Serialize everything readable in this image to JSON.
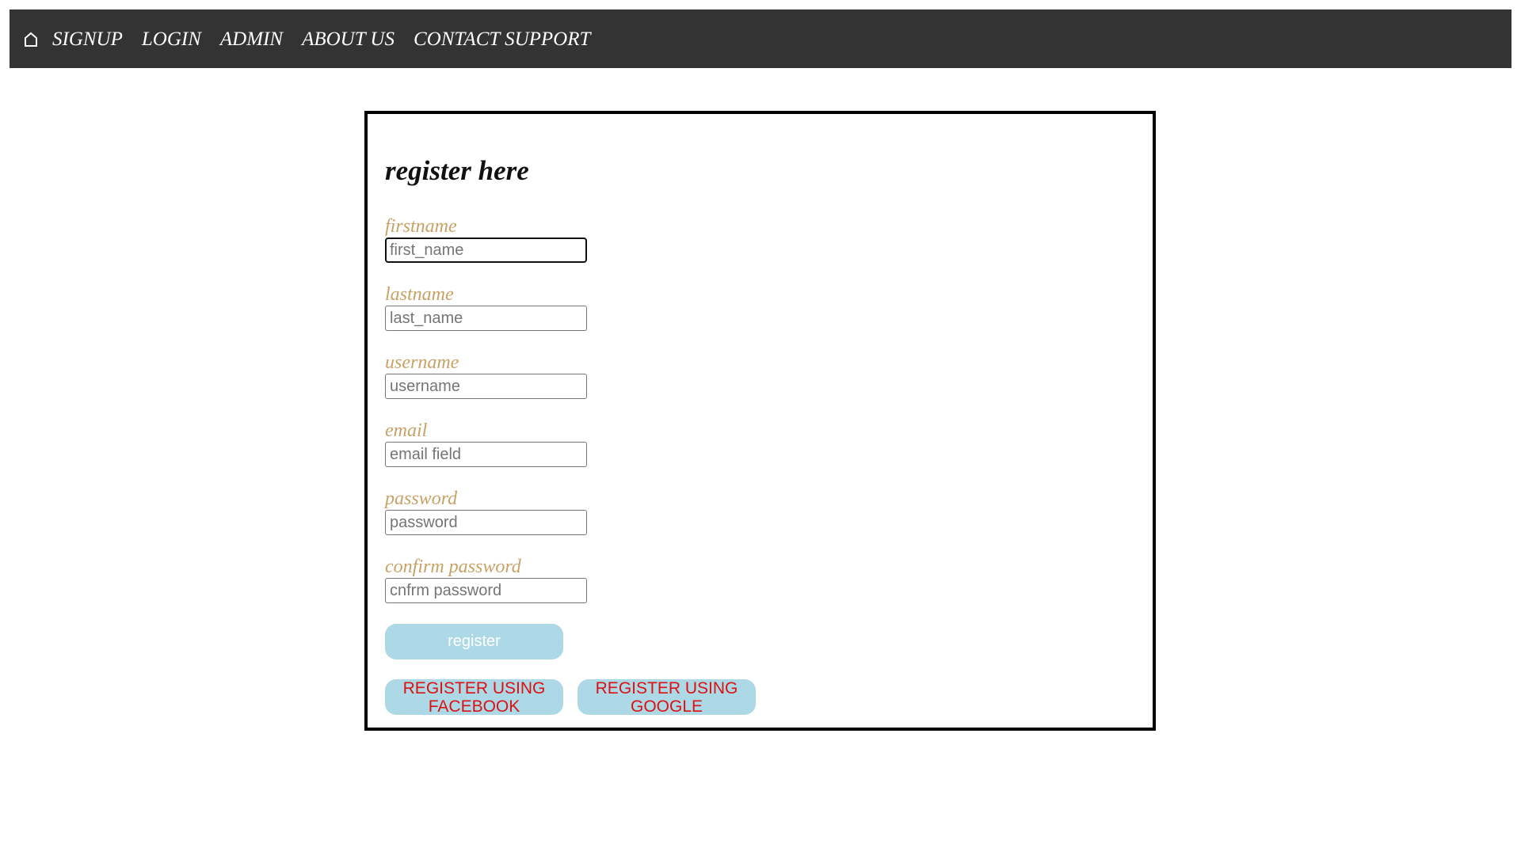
{
  "nav": {
    "home_icon": "home-icon",
    "items": [
      "SIGNUP",
      "LOGIN",
      "ADMIN",
      "ABOUT US",
      "CONTACT SUPPORT"
    ]
  },
  "form": {
    "title": "register here",
    "fields": [
      {
        "label": "firstname",
        "placeholder": "first_name",
        "value": ""
      },
      {
        "label": "lastname",
        "placeholder": "last_name",
        "value": ""
      },
      {
        "label": "username",
        "placeholder": "username",
        "value": ""
      },
      {
        "label": "email",
        "placeholder": "email field",
        "value": ""
      },
      {
        "label": "password",
        "placeholder": "password",
        "value": ""
      },
      {
        "label": "confirm password",
        "placeholder": "cnfrm password",
        "value": ""
      }
    ],
    "register_label": "register",
    "facebook_label": "REGISTER USING FACEBOOK",
    "google_label": "REGISTER USING GOOGLE"
  },
  "colors": {
    "navbar_bg": "#333333",
    "label_color": "#c8a165",
    "button_bg": "#add8e6",
    "social_text": "#dd1111"
  }
}
